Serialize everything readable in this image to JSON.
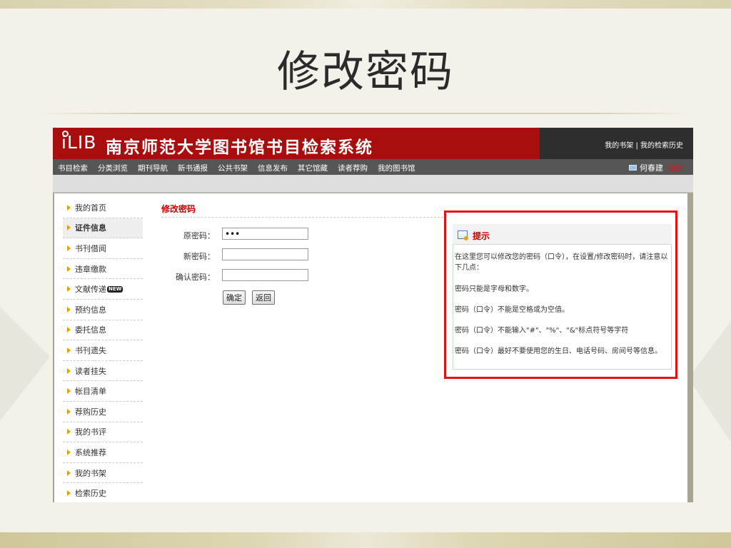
{
  "slide": {
    "title": "修改密码"
  },
  "app": {
    "logo": "iLIB",
    "system_title": "南京师范大学图书馆书目检索系统",
    "top_links": [
      "我的书架",
      "我的检索历史"
    ],
    "nav": [
      "书目检索",
      "分类浏览",
      "期刊导航",
      "新书通报",
      "公共书架",
      "信息发布",
      "其它馆藏",
      "读者荐购",
      "我的图书馆"
    ],
    "user": {
      "name": "何春建",
      "logout": "注销"
    }
  },
  "sidebar": {
    "items": [
      {
        "label": "我的首页"
      },
      {
        "label": "证件信息",
        "active": true
      },
      {
        "label": "书刊借阅"
      },
      {
        "label": "违章缴款"
      },
      {
        "label": "文献传递",
        "badge": "NEW"
      },
      {
        "label": "预约信息"
      },
      {
        "label": "委托信息"
      },
      {
        "label": "书刊遗失"
      },
      {
        "label": "读者挂失"
      },
      {
        "label": "帐目清单"
      },
      {
        "label": "荐购历史"
      },
      {
        "label": "我的书评"
      },
      {
        "label": "系统推荐"
      },
      {
        "label": "我的书架"
      },
      {
        "label": "检索历史"
      }
    ]
  },
  "form": {
    "title": "修改密码",
    "old_label": "原密码：",
    "old_value": "•••",
    "new_label": "新密码：",
    "new_value": "",
    "confirm_label": "确认密码：",
    "confirm_value": "",
    "submit": "确定",
    "back": "返回"
  },
  "tips": {
    "title": "提示",
    "intro": "在这里您可以修改您的密码（口令），在设置/修改密码时，请注意以下几点：",
    "items": [
      "密码只能是字母和数字。",
      "密码（口令）不能是空格或为空值。",
      "密码（口令）不能输入\"#\"、\"%\"、\"&\"标点符号等字符",
      "密码（口令）最好不要使用您的生日、电话号码、房间号等信息。"
    ]
  }
}
